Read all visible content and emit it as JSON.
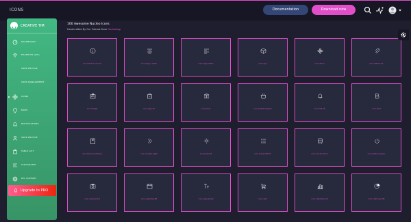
{
  "topbar": {
    "title": "ICONS",
    "documentation_label": "Documentation",
    "download_label": "Download now",
    "icons": [
      "search-icon",
      "activity-icon",
      "avatar",
      "chevron-down-icon"
    ]
  },
  "sidebar": {
    "brand": "CREATIVE TIM",
    "items": [
      {
        "label": "DASHBOARD",
        "icon": "dashboard-icon"
      },
      {
        "label": "EXAMPLES (API)",
        "icon": "wifi-icon"
      },
      {
        "label": "USER PROFILE",
        "icon": ""
      },
      {
        "label": "USER MANAGEMENT",
        "icon": ""
      },
      {
        "label": "ICONS",
        "icon": "atom-icon"
      },
      {
        "label": "MAPS",
        "icon": "pin-icon"
      },
      {
        "label": "NOTIFICATIONS",
        "icon": "bell-icon"
      },
      {
        "label": "USER PROFILE",
        "icon": "user-icon"
      },
      {
        "label": "TABLE LIST",
        "icon": "puzzle-icon"
      },
      {
        "label": "TYPOGRAPHY",
        "icon": "align-icon"
      },
      {
        "label": "RTL SUPPORT",
        "icon": "world-icon"
      }
    ],
    "upgrade_label": "Upgrade to PRO"
  },
  "main": {
    "title": "100 Awesome Nucleo Icons",
    "subtitle_prefix": "Handcrafted By Our Friends From",
    "subtitle_link": "NucleoApp",
    "cards": [
      {
        "label": "icon-alert-circle-exc",
        "icon": "info-icon"
      },
      {
        "label": "icon-align-center",
        "icon": "align-center-icon"
      },
      {
        "label": "icon-align-left-2",
        "icon": "align-left-icon"
      },
      {
        "label": "icon-app",
        "icon": "app-icon"
      },
      {
        "label": "icon-atom",
        "icon": "atom-icon"
      },
      {
        "label": "icon-attach-87",
        "icon": "paperclip-icon"
      },
      {
        "label": "icon-badge",
        "icon": "badge-icon"
      },
      {
        "label": "icon-bag-16",
        "icon": "bag-icon"
      },
      {
        "label": "icon-bank",
        "icon": "bank-icon"
      },
      {
        "label": "icon-basket-simple",
        "icon": "basket-icon"
      },
      {
        "label": "icon-bell-55",
        "icon": "bell-icon"
      },
      {
        "label": "icon-bold",
        "icon": "bold-icon"
      },
      {
        "label": "icon-book-bookmark",
        "icon": "book-icon"
      },
      {
        "label": "icon-double-right",
        "icon": "double-right-icon"
      },
      {
        "label": "icon-bulb-63",
        "icon": "bulb-icon"
      },
      {
        "label": "icon-bullet-list-67",
        "icon": "bullet-list-icon"
      },
      {
        "label": "icon-bus-front-12",
        "icon": "bus-icon"
      },
      {
        "label": "icon-button-power",
        "icon": "power-icon"
      },
      {
        "label": "icon-camera-18",
        "icon": "camera-icon"
      },
      {
        "label": "icon-calendar-60",
        "icon": "calendar-icon"
      },
      {
        "label": "icon-caps-small",
        "icon": "caps-icon"
      },
      {
        "label": "icon-cart",
        "icon": "cart-icon"
      },
      {
        "label": "icon-chart-bar-32",
        "icon": "chart-bar-icon"
      },
      {
        "label": "icon-chart-pie-36",
        "icon": "chart-pie-icon"
      }
    ]
  },
  "colors": {
    "background": "#1e1e2f",
    "accent": "#e14eca",
    "sidebar_green": "#42b883",
    "card_bg": "#27293d",
    "doc_button": "#344675"
  }
}
